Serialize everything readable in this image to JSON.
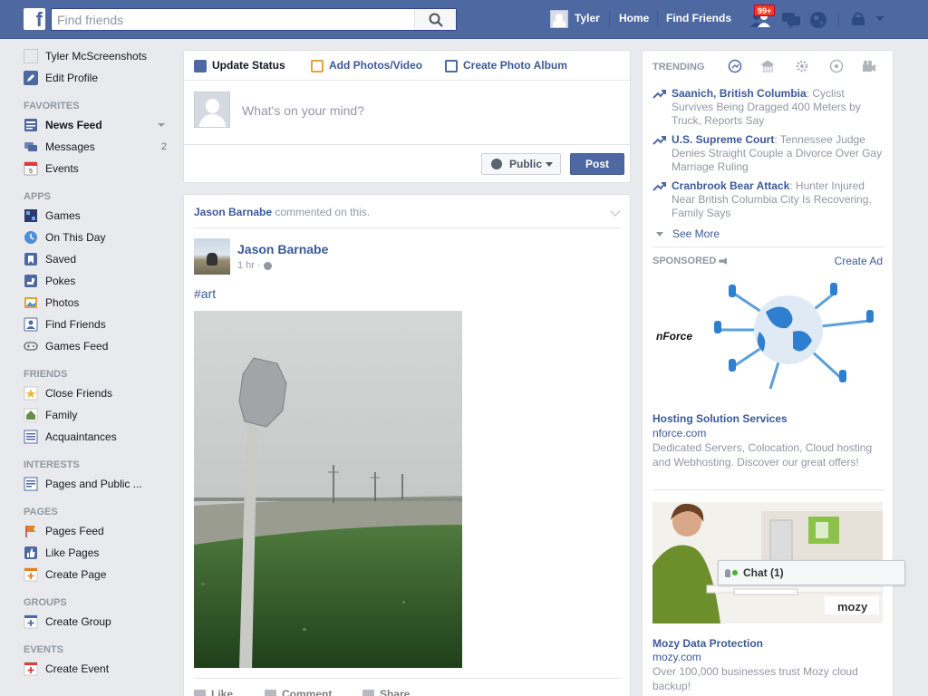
{
  "topbar": {
    "search_placeholder": "Find friends",
    "user_name": "Tyler",
    "home": "Home",
    "find_friends": "Find Friends",
    "friend_requests_count": "99+"
  },
  "leftnav": {
    "profile_name": "Tyler McScreenshots",
    "edit_profile": "Edit Profile",
    "favorites_header": "FAVORITES",
    "favorites": [
      {
        "label": "News Feed",
        "icon": "news-feed-icon"
      },
      {
        "label": "Messages",
        "icon": "messages-icon",
        "count": "2"
      },
      {
        "label": "Events",
        "icon": "calendar-icon"
      }
    ],
    "apps_header": "APPS",
    "apps": [
      {
        "label": "Games",
        "icon": "games-icon"
      },
      {
        "label": "On This Day",
        "icon": "on-this-day-icon"
      },
      {
        "label": "Saved",
        "icon": "bookmark-icon"
      },
      {
        "label": "Pokes",
        "icon": "poke-icon"
      },
      {
        "label": "Photos",
        "icon": "photos-icon"
      },
      {
        "label": "Find Friends",
        "icon": "find-friends-icon"
      },
      {
        "label": "Games Feed",
        "icon": "gamepad-icon"
      }
    ],
    "friends_header": "FRIENDS",
    "friends": [
      {
        "label": "Close Friends",
        "icon": "star-icon"
      },
      {
        "label": "Family",
        "icon": "house-icon"
      },
      {
        "label": "Acquaintances",
        "icon": "list-icon"
      }
    ],
    "interests_header": "INTERESTS",
    "interests": [
      {
        "label": "Pages and Public ...",
        "icon": "pages-list-icon"
      }
    ],
    "pages_header": "PAGES",
    "pages": [
      {
        "label": "Pages Feed",
        "icon": "flag-icon"
      },
      {
        "label": "Like Pages",
        "icon": "like-icon"
      },
      {
        "label": "Create Page",
        "icon": "plus-icon"
      }
    ],
    "groups_header": "GROUPS",
    "groups": [
      {
        "label": "Create Group",
        "icon": "plus-icon"
      }
    ],
    "events_header": "EVENTS",
    "events": [
      {
        "label": "Create Event",
        "icon": "plus-icon"
      }
    ]
  },
  "composer": {
    "tab_update": "Update Status",
    "tab_photos": "Add Photos/Video",
    "tab_album": "Create Photo Album",
    "placeholder": "What's on your mind?",
    "privacy": "Public",
    "post_button": "Post"
  },
  "post": {
    "actor": "Jason Barnabe",
    "activity": " commented on this.",
    "author": "Jason Barnabe",
    "time": "1 hr · ",
    "text": "#art",
    "like": "Like",
    "comment": "Comment",
    "share": "Share"
  },
  "trending": {
    "header": "TRENDING",
    "items": [
      {
        "topic": "Saanich, British Columbia",
        "desc": ": Cyclist Survives Being Dragged 400 Meters by Truck, Reports Say"
      },
      {
        "topic": "U.S. Supreme Court",
        "desc": ": Tennessee Judge Denies Straight Couple a Divorce Over Gay Marriage Ruling"
      },
      {
        "topic": "Cranbrook Bear Attack",
        "desc": ": Hunter Injured Near British Columbia City Is Recovering, Family Says"
      }
    ],
    "see_more": "See More"
  },
  "sponsored": {
    "header": "SPONSORED",
    "create_ad": "Create Ad",
    "ads": [
      {
        "logo_text": "NForce",
        "title": "Hosting Solution Services",
        "url": "nforce.com",
        "desc": "Dedicated Servers, Colocation, Cloud hosting and Webhosting. Discover our great offers!"
      },
      {
        "logo_text": "mozy",
        "title": "Mozy Data Protection",
        "url": "mozy.com",
        "desc": "Over 100,000 businesses trust Mozy cloud backup!"
      }
    ]
  },
  "chat": {
    "label": "Chat (1)"
  },
  "colors": {
    "brand_blue": "#4e69a2",
    "link_blue": "#3b5998",
    "muted": "#9197a3",
    "badge_red": "#f03d25"
  }
}
